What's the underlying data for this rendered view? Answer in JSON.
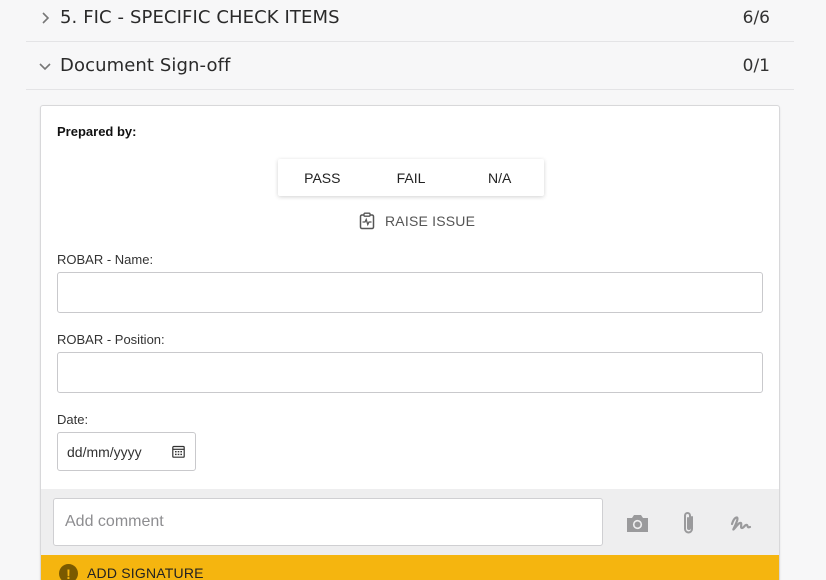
{
  "sections": [
    {
      "title": "5. FIC - SPECIFIC CHECK ITEMS",
      "count": "6/6",
      "expanded": false,
      "chevron_icon": "chevron-right-icon"
    },
    {
      "title": "Document Sign-off",
      "count": "0/1",
      "expanded": true,
      "chevron_icon": "chevron-down-icon"
    }
  ],
  "card": {
    "prepared_label": "Prepared by:",
    "options": [
      "PASS",
      "FAIL",
      "N/A"
    ],
    "raise_issue": {
      "label": "RAISE ISSUE",
      "icon": "clipboard-pulse-icon"
    },
    "fields": {
      "name_label": "ROBAR - Name:",
      "name_value": "",
      "position_label": "ROBAR - Position:",
      "position_value": "",
      "date_label": "Date:",
      "date_placeholder": "dd/mm/yyyy"
    },
    "comment": {
      "placeholder": "Add comment",
      "icons": [
        "camera-icon",
        "paperclip-icon",
        "signature-icon"
      ]
    },
    "signature_bar": {
      "label": "ADD SIGNATURE",
      "icon": "exclamation-icon",
      "color": "#f5b50f"
    }
  }
}
